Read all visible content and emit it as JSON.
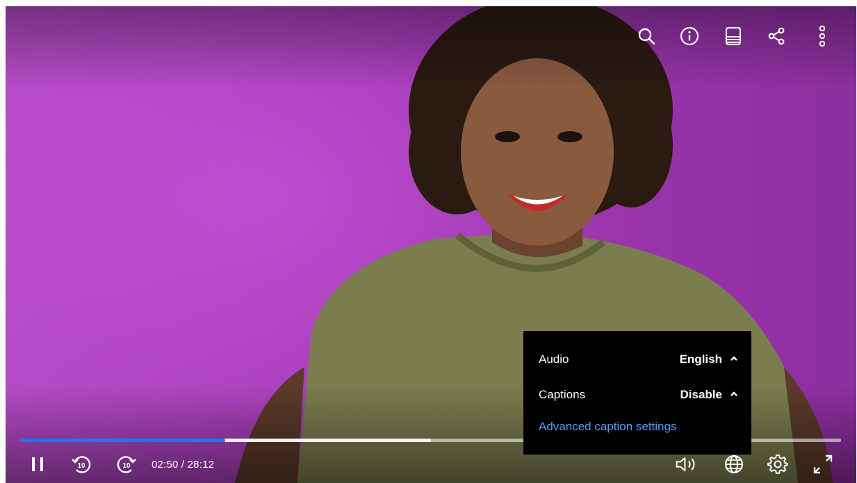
{
  "top_bar": {
    "icons": [
      "search-icon",
      "info-icon",
      "transcript-icon",
      "share-icon",
      "more-vert-icon"
    ]
  },
  "progress": {
    "played_fraction": 0.25,
    "buffered_fraction": 0.5
  },
  "controls": {
    "time_display": "02:50 / 28:12",
    "icons": [
      "pause-icon",
      "rewind-10-icon",
      "forward-10-icon",
      "volume-icon",
      "language-globe-icon",
      "settings-gear-icon",
      "fullscreen-icon"
    ]
  },
  "language_menu": {
    "audio_label": "Audio",
    "audio_value": "English",
    "captions_label": "Captions",
    "captions_value": "Disable",
    "advanced_link": "Advanced caption settings"
  },
  "colors": {
    "accent": "#2f6fea",
    "link": "#5e9df4",
    "backdrop": "#a63cb8",
    "menu_bg": "#000000"
  }
}
